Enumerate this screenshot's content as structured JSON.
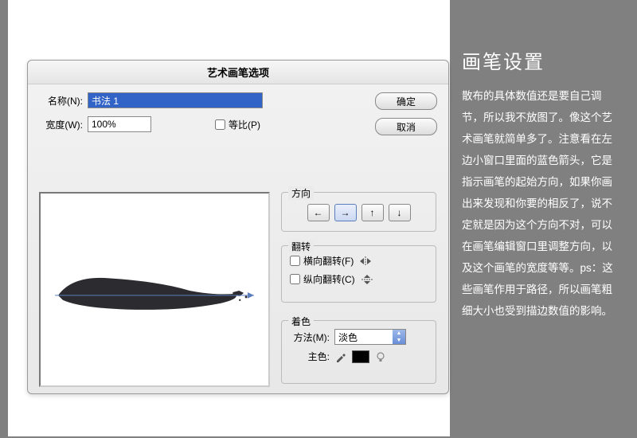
{
  "dialog": {
    "title": "艺术画笔选项",
    "name_label": "名称(N):",
    "name_value": "书法 1",
    "width_label": "宽度(W):",
    "width_value": "100%",
    "proportional_label": "等比(P)",
    "ok": "确定",
    "cancel": "取消"
  },
  "direction": {
    "group": "方向",
    "arrows": [
      "←",
      "→",
      "↑",
      "↓"
    ],
    "active_index": 1
  },
  "flip": {
    "group": "翻转",
    "horiz": "横向翻转(F)",
    "vert": "纵向翻转(C)"
  },
  "colorize": {
    "group": "着色",
    "method_label": "方法(M):",
    "method_value": "淡色",
    "keycolor_label": "主色:"
  },
  "side": {
    "heading": "画笔设置",
    "body": "散布的具体数值还是要自己调节，所以我不放图了。像这个艺术画笔就简单多了。注意看在左边小窗口里面的蓝色箭头，它是指示画笔的起始方向，如果你画出来发现和你要的相反了，说不定就是因为这个方向不对，可以在画笔编辑窗口里调整方向，以及这个画笔的宽度等等。ps：这些画笔作用于路径，所以画笔粗细大小也受到描边数值的影响。"
  }
}
